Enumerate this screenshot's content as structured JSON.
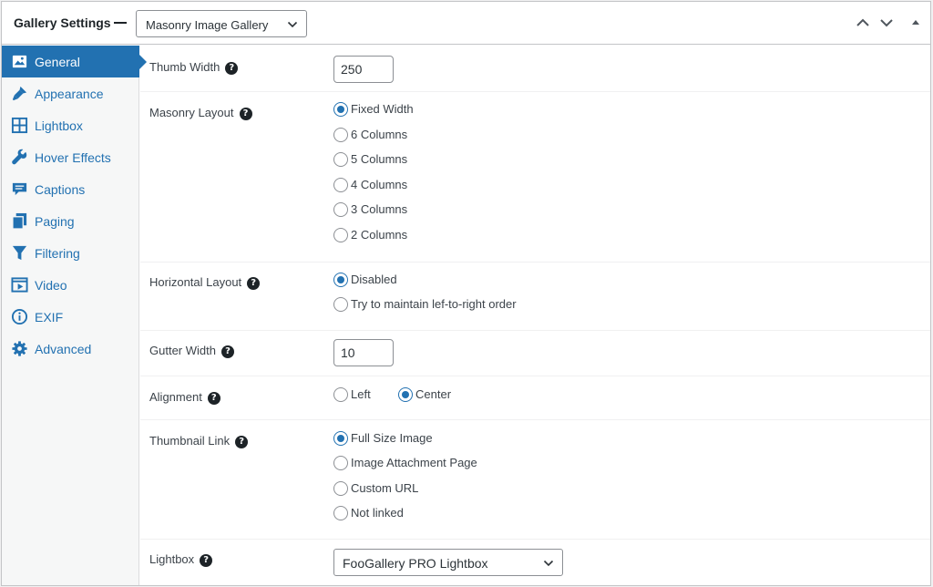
{
  "header": {
    "title": "Gallery Settings",
    "template_selected": "Masonry Image Gallery"
  },
  "sidebar": {
    "items": [
      {
        "label": "General",
        "icon": "image-icon",
        "active": true
      },
      {
        "label": "Appearance",
        "icon": "paintbrush-icon"
      },
      {
        "label": "Lightbox",
        "icon": "grid-icon"
      },
      {
        "label": "Hover Effects",
        "icon": "wrench-icon"
      },
      {
        "label": "Captions",
        "icon": "comment-icon"
      },
      {
        "label": "Paging",
        "icon": "copy-pages-icon"
      },
      {
        "label": "Filtering",
        "icon": "filter-icon"
      },
      {
        "label": "Video",
        "icon": "video-icon"
      },
      {
        "label": "EXIF",
        "icon": "info-icon"
      },
      {
        "label": "Advanced",
        "icon": "gear-icon"
      }
    ]
  },
  "settings": {
    "thumb_width": {
      "label": "Thumb Width",
      "value": "250"
    },
    "masonry_layout": {
      "label": "Masonry Layout",
      "options": [
        "Fixed Width",
        "6 Columns",
        "5 Columns",
        "4 Columns",
        "3 Columns",
        "2 Columns"
      ],
      "selected": "Fixed Width"
    },
    "horizontal_layout": {
      "label": "Horizontal Layout",
      "options": [
        "Disabled",
        "Try to maintain lef-to-right order"
      ],
      "selected": "Disabled"
    },
    "gutter_width": {
      "label": "Gutter Width",
      "value": "10"
    },
    "alignment": {
      "label": "Alignment",
      "options": [
        "Left",
        "Center"
      ],
      "selected": "Center"
    },
    "thumbnail_link": {
      "label": "Thumbnail Link",
      "options": [
        "Full Size Image",
        "Image Attachment Page",
        "Custom URL",
        "Not linked"
      ],
      "selected": "Full Size Image"
    },
    "lightbox": {
      "label": "Lightbox",
      "value": "FooGallery PRO Lightbox"
    }
  },
  "help_glyph": "?",
  "colors": {
    "accent": "#2271b1",
    "text": "#3c434a"
  }
}
